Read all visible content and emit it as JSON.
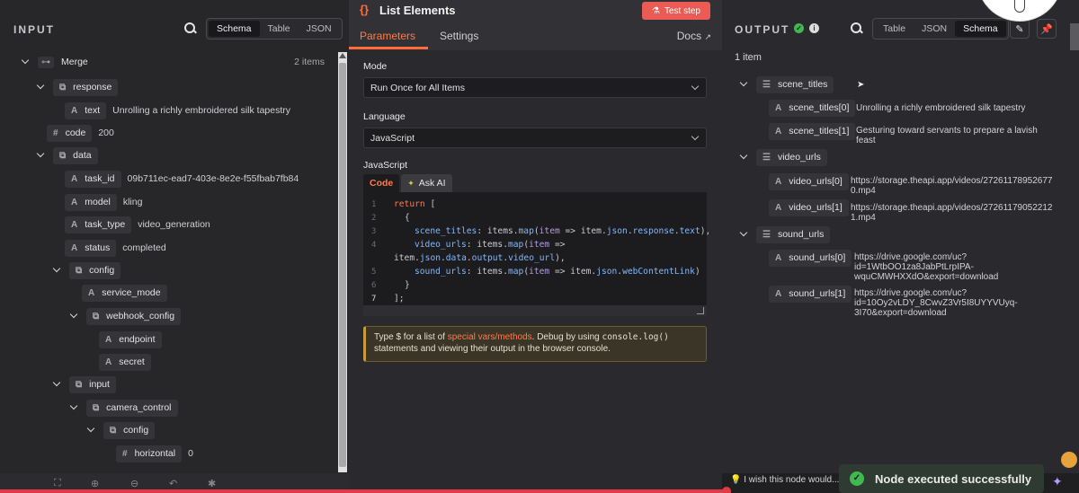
{
  "input": {
    "title": "INPUT",
    "tabs": [
      "Schema",
      "Table",
      "JSON"
    ],
    "active_tab": "Schema",
    "root": {
      "name": "Merge",
      "count": "2 items"
    },
    "rows": [
      {
        "label": "response",
        "icon": "obj"
      },
      {
        "label": "text",
        "icon": "A",
        "value": "Unrolling a richly embroidered silk tapestry"
      },
      {
        "label": "code",
        "icon": "#",
        "value": "200"
      },
      {
        "label": "data",
        "icon": "obj"
      },
      {
        "label": "task_id",
        "icon": "A",
        "value": "09b711ec-ead7-403e-8e2e-f55fbab7fb84"
      },
      {
        "label": "model",
        "icon": "A",
        "value": "kling"
      },
      {
        "label": "task_type",
        "icon": "A",
        "value": "video_generation"
      },
      {
        "label": "status",
        "icon": "A",
        "value": "completed"
      },
      {
        "label": "config",
        "icon": "obj"
      },
      {
        "label": "service_mode",
        "icon": "A"
      },
      {
        "label": "webhook_config",
        "icon": "obj"
      },
      {
        "label": "endpoint",
        "icon": "A"
      },
      {
        "label": "secret",
        "icon": "A"
      },
      {
        "label": "input",
        "icon": "obj"
      },
      {
        "label": "camera_control",
        "icon": "obj"
      },
      {
        "label": "config",
        "icon": "obj"
      },
      {
        "label": "horizontal",
        "icon": "#",
        "value": "0"
      }
    ]
  },
  "node": {
    "icon": "{}",
    "title": "List Elements",
    "test_button": "Test step",
    "tabs": {
      "parameters": "Parameters",
      "settings": "Settings"
    },
    "docs": "Docs",
    "mode_label": "Mode",
    "mode_value": "Run Once for All Items",
    "language_label": "Language",
    "language_value": "JavaScript",
    "code_label": "JavaScript",
    "code_tab": "Code",
    "ask_ai_tab": "Ask AI",
    "line_numbers": [
      "1",
      "2",
      "3",
      "4",
      "",
      "5",
      "6",
      "7"
    ],
    "hint_prefix": "Type $ for a list of ",
    "hint_link": "special vars/methods",
    "hint_middle": ". Debug by using ",
    "hint_code": "console.log()",
    "hint_suffix": " statements and viewing their output in the browser console."
  },
  "output": {
    "title": "OUTPUT",
    "tabs": [
      "Table",
      "JSON",
      "Schema"
    ],
    "active_tab": "Schema",
    "items_count": "1 item",
    "groups": [
      {
        "name": "scene_titles",
        "items": [
          {
            "key": "scene_titles[0]",
            "value": [
              "Unrolling a richly embroidered silk tapestry"
            ]
          },
          {
            "key": "scene_titles[1]",
            "value": [
              "Gesturing toward servants to prepare a lavish",
              "feast"
            ]
          }
        ]
      },
      {
        "name": "video_urls",
        "items": [
          {
            "key": "video_urls[0]",
            "value": [
              "https://storage.theapi.app/videos/27261178952677",
              "0.mp4"
            ]
          },
          {
            "key": "video_urls[1]",
            "value": [
              "https://storage.theapi.app/videos/27261179052212",
              "1.mp4"
            ]
          }
        ]
      },
      {
        "name": "sound_urls",
        "items": [
          {
            "key": "sound_urls[0]",
            "value": [
              "https://drive.google.com/uc?",
              "id=1WtbOO1za8JabPtLrpIPA-",
              "wquCMWHXXdO&export=download"
            ]
          },
          {
            "key": "sound_urls[1]",
            "value": [
              "https://drive.google.com/uc?",
              "id=10Oy2vLDY_8CwvZ3Vr5I8UYYVUyq-",
              "3I70&export=download"
            ]
          }
        ]
      }
    ]
  },
  "footer": {
    "wish": "I wish this node would...",
    "toast": "Node executed successfully"
  },
  "colors": {
    "accent": "#ff6d3a",
    "success": "#3fb950",
    "progress": "#e63946"
  }
}
